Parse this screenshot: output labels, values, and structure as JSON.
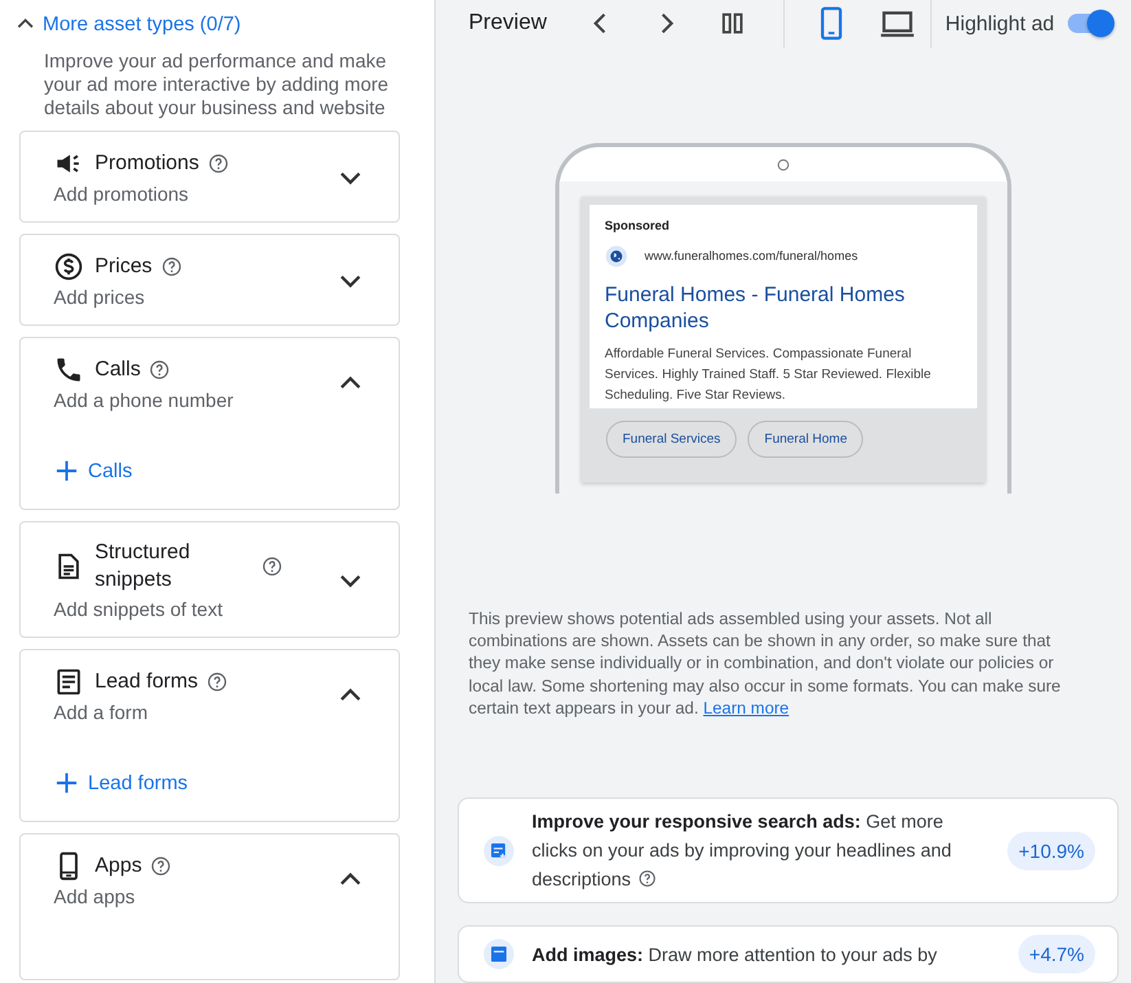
{
  "header": {
    "label": "More asset types (0/7)",
    "expanded": true
  },
  "description": "Improve your ad performance and make your ad more interactive by adding more details about your business and website",
  "assets": [
    {
      "kind": "promotions",
      "title": "Promotions",
      "subtitle": "Add promotions",
      "expanded": false
    },
    {
      "kind": "prices",
      "title": "Prices",
      "subtitle": "Add prices",
      "expanded": false
    },
    {
      "kind": "calls",
      "title": "Calls",
      "subtitle": "Add a phone number",
      "expanded": true,
      "add_label": "Calls"
    },
    {
      "kind": "snippets",
      "title": "Structured snippets",
      "subtitle": "Add snippets of text",
      "expanded": false
    },
    {
      "kind": "forms",
      "title": "Lead forms",
      "subtitle": "Add a form",
      "expanded": true,
      "add_label": "Lead forms"
    },
    {
      "kind": "apps",
      "title": "Apps",
      "subtitle": "Add apps",
      "expanded": true
    }
  ],
  "preview": {
    "title": "Preview",
    "devices": [
      {
        "kind": "mobile",
        "selected": true
      },
      {
        "kind": "desktop",
        "selected": false
      }
    ],
    "highlight": {
      "label": "Highlight ad",
      "on": true
    }
  },
  "ad": {
    "sponsored": "Sponsored",
    "url": "www.funeralhomes.com/funeral/homes",
    "headline": "Funeral Homes - Funeral Homes Companies",
    "description": "Affordable Funeral Services. Compassionate Funeral Services. Highly Trained Staff. 5 Star Reviewed. Flexible Scheduling. Five Star Reviews.",
    "sitelinks": [
      "Funeral Services",
      "Funeral Home"
    ]
  },
  "disclaimer": {
    "text": "This preview shows potential ads assembled using your assets. Not all combinations are shown. Assets can be shown in any order, so make sure that they make sense individually or in combination, and don't violate our policies or local law. Some shortening may also occur in some formats. You can make sure certain text appears in your ad.",
    "link": "Learn more"
  },
  "recommendations": [
    {
      "kind": "ads",
      "text": "**Improve your responsive search ads:** Get more clicks on your ads by improving your headlines and descriptions",
      "help": true,
      "uplift": "+10.9%"
    },
    {
      "kind": "images",
      "text": "**Add images:** Draw more attention to your ads by",
      "help": false,
      "uplift": "+4.7%"
    }
  ]
}
